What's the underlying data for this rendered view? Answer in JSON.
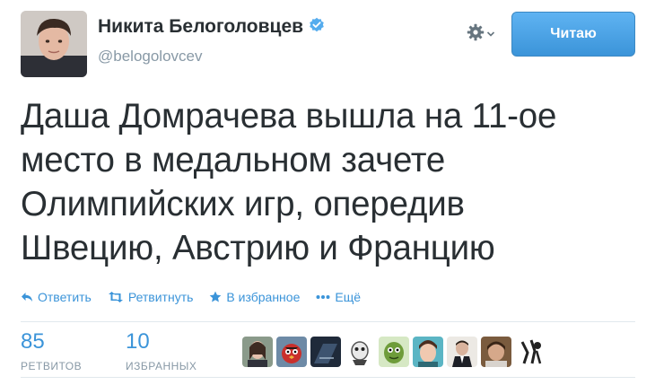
{
  "user": {
    "name": "Никита Белоголовцев",
    "handle": "@belogolovcev",
    "verified": true
  },
  "follow_button": {
    "label": "Читаю"
  },
  "tweet": {
    "lines": [
      "Даша Домрачева вышла на 11-ое",
      "место в медальном зачете",
      "Олимпийских игр, опередив",
      "Швецию, Австрию и Францию"
    ]
  },
  "actions": {
    "reply": "Ответить",
    "retweet": "Ретвитнуть",
    "favorite": "В избранное",
    "more": "Ещё"
  },
  "stats": {
    "retweets": {
      "count": "85",
      "label": "РЕТВИТОВ"
    },
    "favorites": {
      "count": "10",
      "label": "ИЗБРАННЫХ"
    }
  },
  "colors": {
    "accent": "#3b94d9",
    "muted": "#8899a6",
    "text": "#292f33",
    "verified": "#55acee"
  },
  "icons": [
    "verified-badge-icon",
    "gear-icon",
    "chevron-down-icon",
    "reply-icon",
    "retweet-icon",
    "star-icon",
    "more-dots-icon"
  ]
}
